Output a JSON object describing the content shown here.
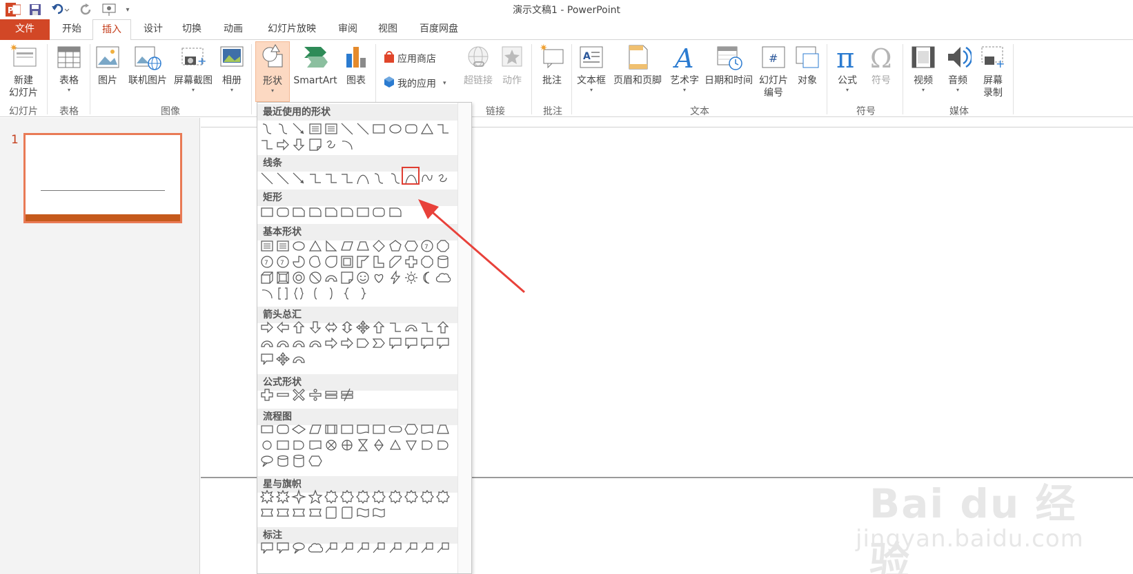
{
  "window": {
    "title": "演示文稿1 - PowerPoint"
  },
  "tabs": [
    "文件",
    "开始",
    "插入",
    "设计",
    "切换",
    "动画",
    "幻灯片放映",
    "审阅",
    "视图",
    "百度网盘"
  ],
  "ribbon": {
    "buttons": {
      "new_slide": "新建",
      "new_slide2": "幻灯片",
      "table": "表格",
      "picture": "图片",
      "online_picture": "联机图片",
      "screenshot": "屏幕截图",
      "album": "相册",
      "shapes": "形状",
      "smartart": "SmartArt",
      "chart": "图表",
      "store": "应用商店",
      "my_apps": "我的应用",
      "hyperlink": "超链接",
      "action": "动作",
      "comment": "批注",
      "textbox": "文本框",
      "header_footer": "页眉和页脚",
      "wordart": "艺术字",
      "datetime": "日期和时间",
      "slide_number": "幻灯片",
      "slide_number2": "编号",
      "object": "对象",
      "equation": "公式",
      "symbol": "符号",
      "video": "视频",
      "audio": "音频",
      "screen_record": "屏幕",
      "screen_record2": "录制"
    },
    "groups": {
      "slides": "幻灯片",
      "tables": "表格",
      "images": "图像",
      "links": "链接",
      "comments": "批注",
      "text": "文本",
      "symbols": "符号",
      "media": "媒体"
    }
  },
  "slides": {
    "current_number": "1"
  },
  "shapes_menu": {
    "categories": {
      "recent": "最近使用的形状",
      "lines": "线条",
      "rectangles": "矩形",
      "basic": "基本形状",
      "arrows": "箭头总汇",
      "equation": "公式形状",
      "flowchart": "流程图",
      "stars": "星与旗帜",
      "callouts": "标注"
    },
    "highlighted_shape": "curve"
  },
  "watermark": {
    "brand": "Bai du 经验",
    "url": "jingyan.baidu.com"
  },
  "colors": {
    "accent": "#d24726",
    "highlight": "#e03c31",
    "selected_fill": "#fcd9c2"
  }
}
